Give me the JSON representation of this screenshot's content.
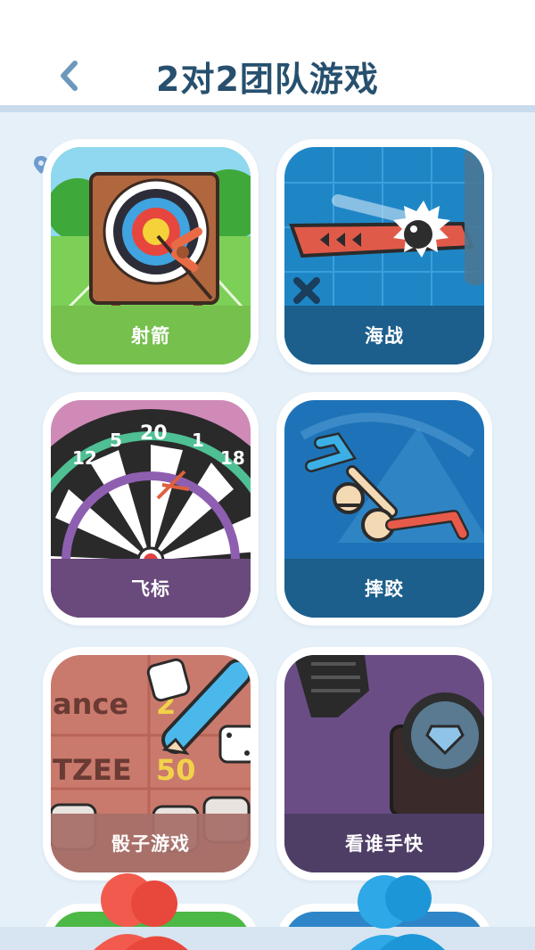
{
  "header": {
    "title": "2对2团队游戏",
    "back_icon": "chevron-left-icon"
  },
  "colors": {
    "title": "#27506e",
    "background": "#e6f0f8",
    "archery_label_bg": "#76c04e",
    "naval_label_bg": "#1c5e8c",
    "darts_label_bg": "#6a4a7c",
    "wrestling_label_bg": "#1c5e8c",
    "dice_label_bg": "#a8706a",
    "reflex_label_bg": "#4e3e66"
  },
  "games": [
    {
      "label": "射箭",
      "icon": "archery-target-icon"
    },
    {
      "label": "海战",
      "icon": "naval-battle-icon"
    },
    {
      "label": "飞标",
      "icon": "dartboard-icon"
    },
    {
      "label": "摔跤",
      "icon": "wrestling-icon"
    },
    {
      "label": "骰子游戏",
      "icon": "dice-icon"
    },
    {
      "label": "看谁手快",
      "icon": "fast-hands-icon"
    }
  ],
  "dice_art": {
    "word1": "ance",
    "word2": "TZEE",
    "num1": "2",
    "num2": "50"
  },
  "dart_numbers": [
    "12",
    "5",
    "20",
    "1",
    "18"
  ]
}
